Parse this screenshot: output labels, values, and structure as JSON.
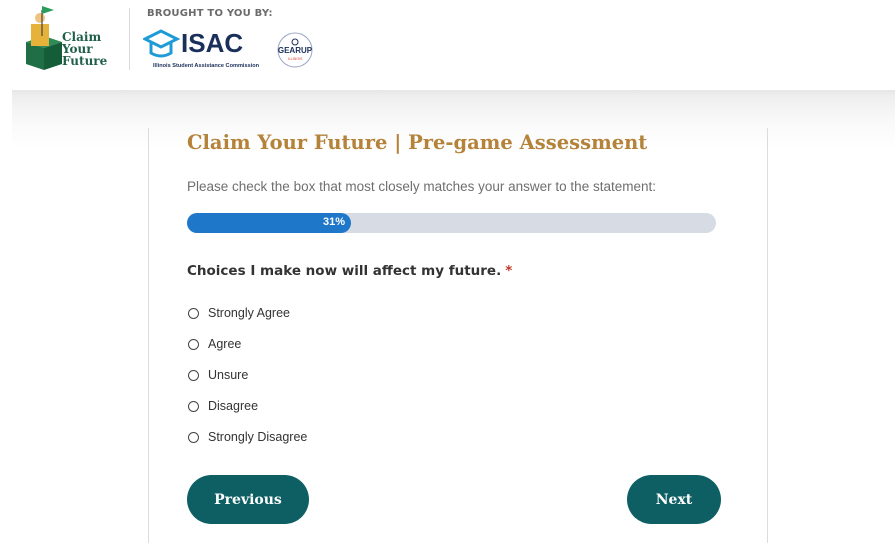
{
  "header": {
    "logo_lines": [
      "Claim",
      "Your",
      "Future"
    ],
    "brought_label": "BROUGHT TO YOU BY:",
    "isac_text": "ISAC",
    "isac_subtext": "Illinois Student Assistance Commission",
    "gearup_text": "GEARUP",
    "gearup_sub": "ILLINOIS"
  },
  "form": {
    "title": "Claim Your Future | Pre-game Assessment",
    "instructions": "Please check the box that most closely matches your answer to the statement:",
    "progress": {
      "percent": 31,
      "label": "31%"
    },
    "question": "Choices I make now will affect my future.",
    "required_marker": "*",
    "options": [
      {
        "label": "Strongly Agree"
      },
      {
        "label": "Agree"
      },
      {
        "label": "Unsure"
      },
      {
        "label": "Disagree"
      },
      {
        "label": "Strongly Disagree"
      }
    ]
  },
  "buttons": {
    "previous": "Previous",
    "next": "Next"
  },
  "colors": {
    "title": "#b5823a",
    "progress": "#1f77c9",
    "button": "#0d5f63",
    "required": "#c0392b"
  }
}
